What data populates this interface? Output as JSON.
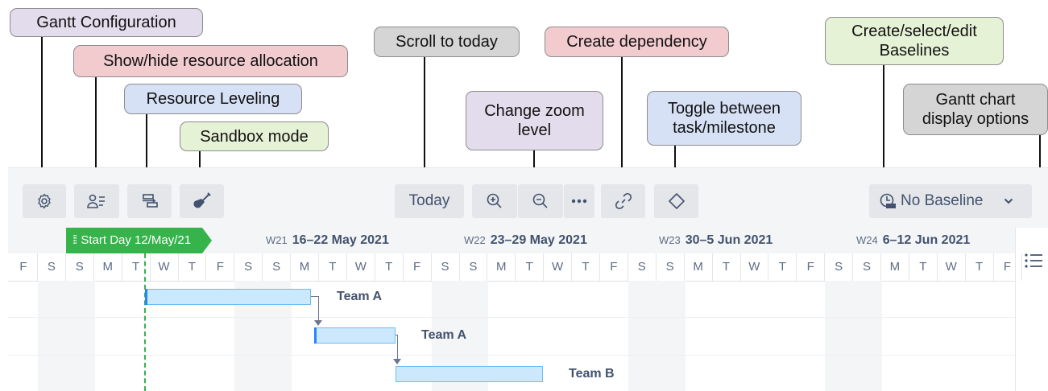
{
  "callouts": {
    "gantt_configuration": "Gantt Configuration",
    "show_hide_resource": "Show/hide resource allocation",
    "resource_leveling": "Resource Leveling",
    "sandbox_mode": "Sandbox mode",
    "scroll_to_today": "Scroll to today",
    "change_zoom": "Change zoom\nlevel",
    "create_dependency": "Create dependency",
    "toggle_task_milestone": "Toggle between\ntask/milestone",
    "baselines": "Create/select/edit\nBaselines",
    "display_options": "Gantt chart\ndisplay options"
  },
  "toolbar": {
    "today_label": "Today",
    "baseline_label": "No Baseline",
    "icons": [
      "gear-icon",
      "resource-allocation-icon",
      "resource-leveling-icon",
      "sandbox-shovel-icon",
      "zoom-in-icon",
      "zoom-out-icon",
      "more-icon",
      "link-icon",
      "diamond-icon",
      "baseline-icon",
      "chevron-down-icon",
      "list-icon"
    ]
  },
  "timeline": {
    "milestone_flag": "Start Day 12/May/21",
    "weeks": [
      {
        "num": "W21",
        "range": "16–22 May 2021"
      },
      {
        "num": "W22",
        "range": "23–29 May 2021"
      },
      {
        "num": "W23",
        "range": "30–5 Jun 2021"
      },
      {
        "num": "W24",
        "range": "6–12 Jun 2021"
      }
    ],
    "days": [
      "F",
      "S",
      "S",
      "M",
      "T",
      "W",
      "T",
      "F",
      "S",
      "S",
      "M",
      "T",
      "W",
      "T",
      "F",
      "S",
      "S",
      "M",
      "T",
      "W",
      "T",
      "F",
      "S",
      "S",
      "M",
      "T",
      "W",
      "T",
      "F",
      "S",
      "S",
      "M",
      "T",
      "W",
      "T",
      "F"
    ]
  },
  "tasks": [
    {
      "label": "Team A"
    },
    {
      "label": "Team A"
    },
    {
      "label": "Team B"
    }
  ],
  "colors": {
    "bar_fill": "#cbe8fd",
    "bar_border": "#6cbdf3",
    "milestone": "#36b34a",
    "toolbar_bg": "#f4f5f7"
  }
}
